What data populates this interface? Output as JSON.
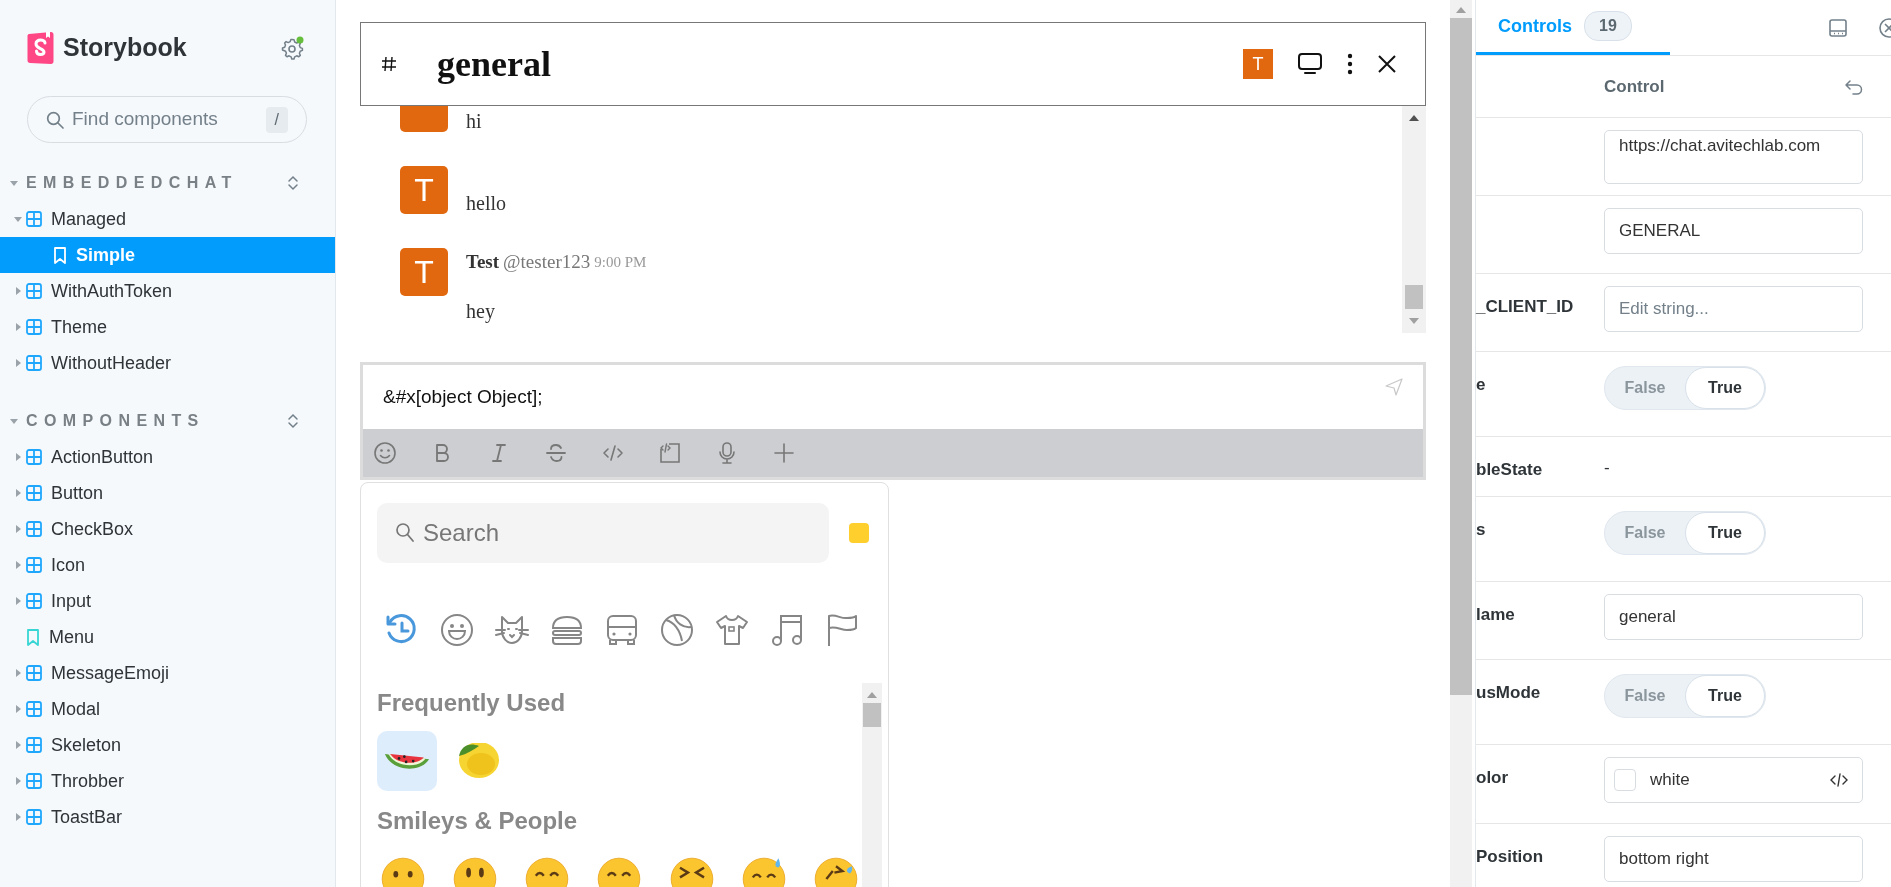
{
  "sidebar": {
    "brand": "Storybook",
    "search": {
      "placeholder": "Find components",
      "shortcut": "/"
    },
    "sections": [
      {
        "title": "EMBEDDEDCHAT",
        "items": [
          {
            "kind": "component",
            "label": "Managed",
            "expanded": true,
            "selected": false,
            "children": [
              {
                "kind": "story",
                "label": "Simple",
                "selected": true
              }
            ]
          },
          {
            "kind": "component",
            "label": "WithAuthToken",
            "expanded": false,
            "selected": false
          },
          {
            "kind": "component",
            "label": "Theme",
            "expanded": false,
            "selected": false
          },
          {
            "kind": "component",
            "label": "WithoutHeader",
            "expanded": false,
            "selected": false
          }
        ]
      },
      {
        "title": "COMPONENTS",
        "items": [
          {
            "kind": "component",
            "label": "ActionButton",
            "expanded": false,
            "selected": false
          },
          {
            "kind": "component",
            "label": "Button",
            "expanded": false,
            "selected": false
          },
          {
            "kind": "component",
            "label": "CheckBox",
            "expanded": false,
            "selected": false
          },
          {
            "kind": "component",
            "label": "Icon",
            "expanded": false,
            "selected": false
          },
          {
            "kind": "component",
            "label": "Input",
            "expanded": false,
            "selected": false
          },
          {
            "kind": "story",
            "label": "Menu",
            "selected": false
          },
          {
            "kind": "component",
            "label": "MessageEmoji",
            "expanded": false,
            "selected": false
          },
          {
            "kind": "component",
            "label": "Modal",
            "expanded": false,
            "selected": false
          },
          {
            "kind": "component",
            "label": "Skeleton",
            "expanded": false,
            "selected": false
          },
          {
            "kind": "component",
            "label": "Throbber",
            "expanded": false,
            "selected": false
          },
          {
            "kind": "component",
            "label": "ToastBar",
            "expanded": false,
            "selected": false
          }
        ]
      }
    ]
  },
  "chat": {
    "header": {
      "channel": "general",
      "avatar": "T"
    },
    "messages": [
      {
        "text": "hi"
      },
      {
        "avatar": "T",
        "text": "hello"
      },
      {
        "avatar": "T",
        "name": "Test",
        "username": "@tester123",
        "time": "9:00 PM",
        "text": "hey"
      }
    ],
    "composer": {
      "value": "&#x[object Object];"
    },
    "toolbar": [
      {
        "kind": "emoji"
      },
      {
        "kind": "bold"
      },
      {
        "kind": "italic"
      },
      {
        "kind": "strike"
      },
      {
        "kind": "code"
      },
      {
        "kind": "codeblock"
      },
      {
        "kind": "mic"
      },
      {
        "kind": "plus"
      }
    ]
  },
  "emoji_picker": {
    "search": {
      "placeholder": "Search"
    },
    "categories": [
      {
        "kind": "recent",
        "selected": true
      },
      {
        "kind": "smileys",
        "selected": false
      },
      {
        "kind": "animals",
        "selected": false
      },
      {
        "kind": "food",
        "selected": false
      },
      {
        "kind": "travel",
        "selected": false
      },
      {
        "kind": "activity",
        "selected": false
      },
      {
        "kind": "objects",
        "selected": false
      },
      {
        "kind": "symbols",
        "selected": false
      },
      {
        "kind": "flags",
        "selected": false
      }
    ],
    "sections": [
      {
        "title": "Frequently Used",
        "emojis": [
          {
            "kind": "watermelon",
            "selected": true
          },
          {
            "kind": "lemon",
            "selected": false
          }
        ]
      },
      {
        "title": "Smileys & People",
        "emojis": [
          {
            "kind": "grinning",
            "selected": false
          },
          {
            "kind": "smiley",
            "selected": false
          },
          {
            "kind": "smile",
            "selected": false
          },
          {
            "kind": "grin",
            "selected": false
          },
          {
            "kind": "laughing",
            "selected": false
          },
          {
            "kind": "sweat_smile",
            "selected": false
          },
          {
            "kind": "rofl",
            "selected": false
          }
        ]
      }
    ]
  },
  "controls_panel": {
    "tabs": [
      {
        "label": "Controls",
        "count": "19",
        "selected": true
      }
    ],
    "column": "Control",
    "rows": [
      {
        "kind": "text",
        "value": "https://chat.avitechlab.com"
      },
      {
        "kind": "text",
        "value": "GENERAL"
      },
      {
        "kind": "text",
        "name": "_CLIENT_ID",
        "placeholder": "Edit string..."
      },
      {
        "kind": "boolean",
        "name": "e",
        "options": [
          {
            "label": "False",
            "selected": false
          },
          {
            "label": "True",
            "selected": true
          }
        ]
      },
      {
        "kind": "none",
        "name": "bleState",
        "value": "-"
      },
      {
        "kind": "boolean",
        "name": "s",
        "options": [
          {
            "label": "False",
            "selected": false
          },
          {
            "label": "True",
            "selected": true
          }
        ]
      },
      {
        "kind": "text",
        "name": "lame",
        "value": "general"
      },
      {
        "kind": "boolean",
        "name": "usMode",
        "options": [
          {
            "label": "False",
            "selected": false
          },
          {
            "label": "True",
            "selected": true
          }
        ]
      },
      {
        "kind": "color",
        "name": "olor",
        "value": "white"
      },
      {
        "kind": "text",
        "name": "Position",
        "value": "bottom right"
      }
    ]
  }
}
